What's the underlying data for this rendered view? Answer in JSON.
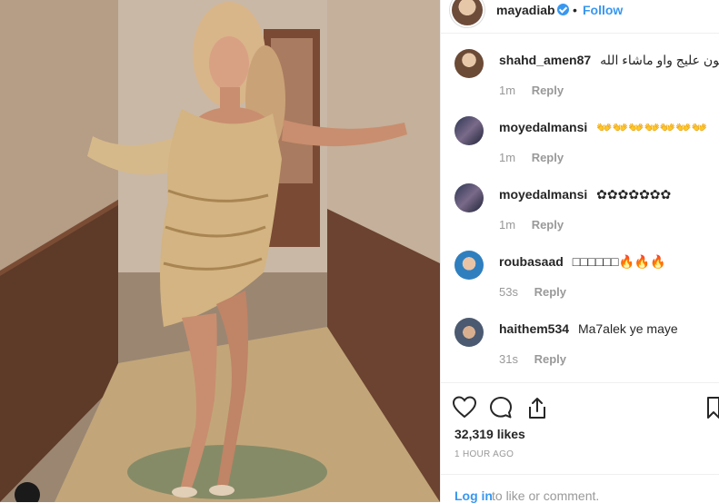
{
  "post": {
    "username": "mayadiab",
    "separator": "•",
    "follow_label": "Follow"
  },
  "comments": [
    {
      "user": "shahd_amen87",
      "text": "اللون عليج واو ماشاء الله",
      "time": "1m",
      "reply": "Reply"
    },
    {
      "user": "moyedalmansi",
      "text": "👐👐👐👐👐👐👐",
      "time": "1m",
      "reply": "Reply"
    },
    {
      "user": "moyedalmansi",
      "text": "✿✿✿✿✿✿✿",
      "time": "1m",
      "reply": "Reply"
    },
    {
      "user": "roubasaad",
      "text": "□□□□□□🔥🔥🔥",
      "time": "53s",
      "reply": "Reply"
    },
    {
      "user": "haithem534",
      "text": "Ma7alek ye maye",
      "time": "31s",
      "reply": "Reply"
    }
  ],
  "stats": {
    "likes": "32,319 likes",
    "time_ago": "1 HOUR AGO"
  },
  "login": {
    "link": "Log in",
    "rest": "to like or comment."
  },
  "icons": {
    "like": "heart-icon",
    "comment": "comment-icon",
    "share": "share-icon",
    "save": "bookmark-icon"
  }
}
